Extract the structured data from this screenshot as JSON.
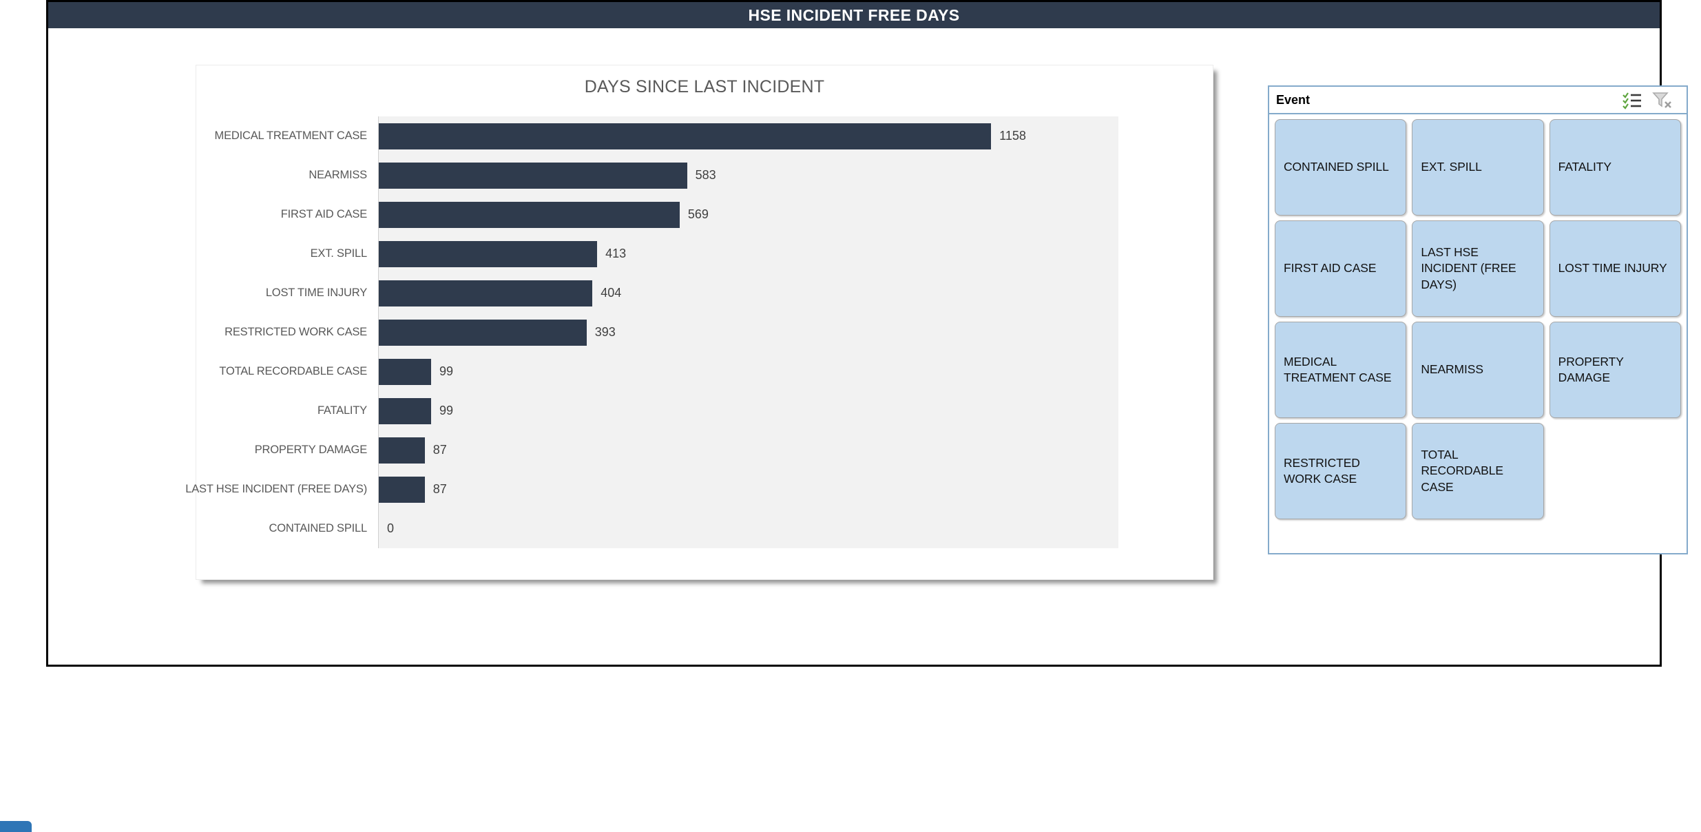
{
  "window": {
    "title_bar": "HSE INCIDENT FREE DAYS"
  },
  "chart": {
    "title": "DAYS SINCE LAST INCIDENT"
  },
  "chart_data": {
    "type": "bar",
    "orientation": "horizontal",
    "title": "DAYS SINCE LAST INCIDENT",
    "categories": [
      "MEDICAL TREATMENT CASE",
      "NEARMISS",
      "FIRST AID CASE",
      "EXT. SPILL",
      "LOST TIME INJURY",
      "RESTRICTED WORK CASE",
      "TOTAL RECORDABLE CASE",
      "FATALITY",
      "PROPERTY DAMAGE",
      "LAST HSE INCIDENT (FREE DAYS)",
      "CONTAINED SPILL"
    ],
    "values": [
      1158,
      583,
      569,
      413,
      404,
      393,
      99,
      99,
      87,
      87,
      0
    ],
    "xlabel": "",
    "ylabel": "",
    "xlim": [
      0,
      1400
    ],
    "grid": false,
    "data_labels": true,
    "legend": "none",
    "bar_color": "#2F3B4D",
    "plot_background": "#F2F2F2"
  },
  "slicer": {
    "title": "Event",
    "icons": {
      "multi_select": "multi-select-icon",
      "clear_filter": "clear-filter-icon"
    },
    "items": [
      "CONTAINED SPILL",
      "EXT. SPILL",
      "FATALITY",
      "FIRST AID CASE",
      "LAST HSE INCIDENT (FREE DAYS)",
      "LOST TIME INJURY",
      "MEDICAL TREATMENT CASE",
      "NEARMISS",
      "PROPERTY DAMAGE",
      "RESTRICTED WORK CASE",
      "TOTAL RECORDABLE CASE"
    ],
    "button_color": "#BDD7EE"
  },
  "colors": {
    "header_bg": "#2F3B4D",
    "header_text": "#FFFFFF",
    "chart_title_text": "#595959",
    "category_text": "#595959",
    "value_text": "#404040",
    "slicer_border": "#84AACB",
    "slicer_button_border": "#A6A6A6",
    "check_green": "#5FA53F"
  }
}
